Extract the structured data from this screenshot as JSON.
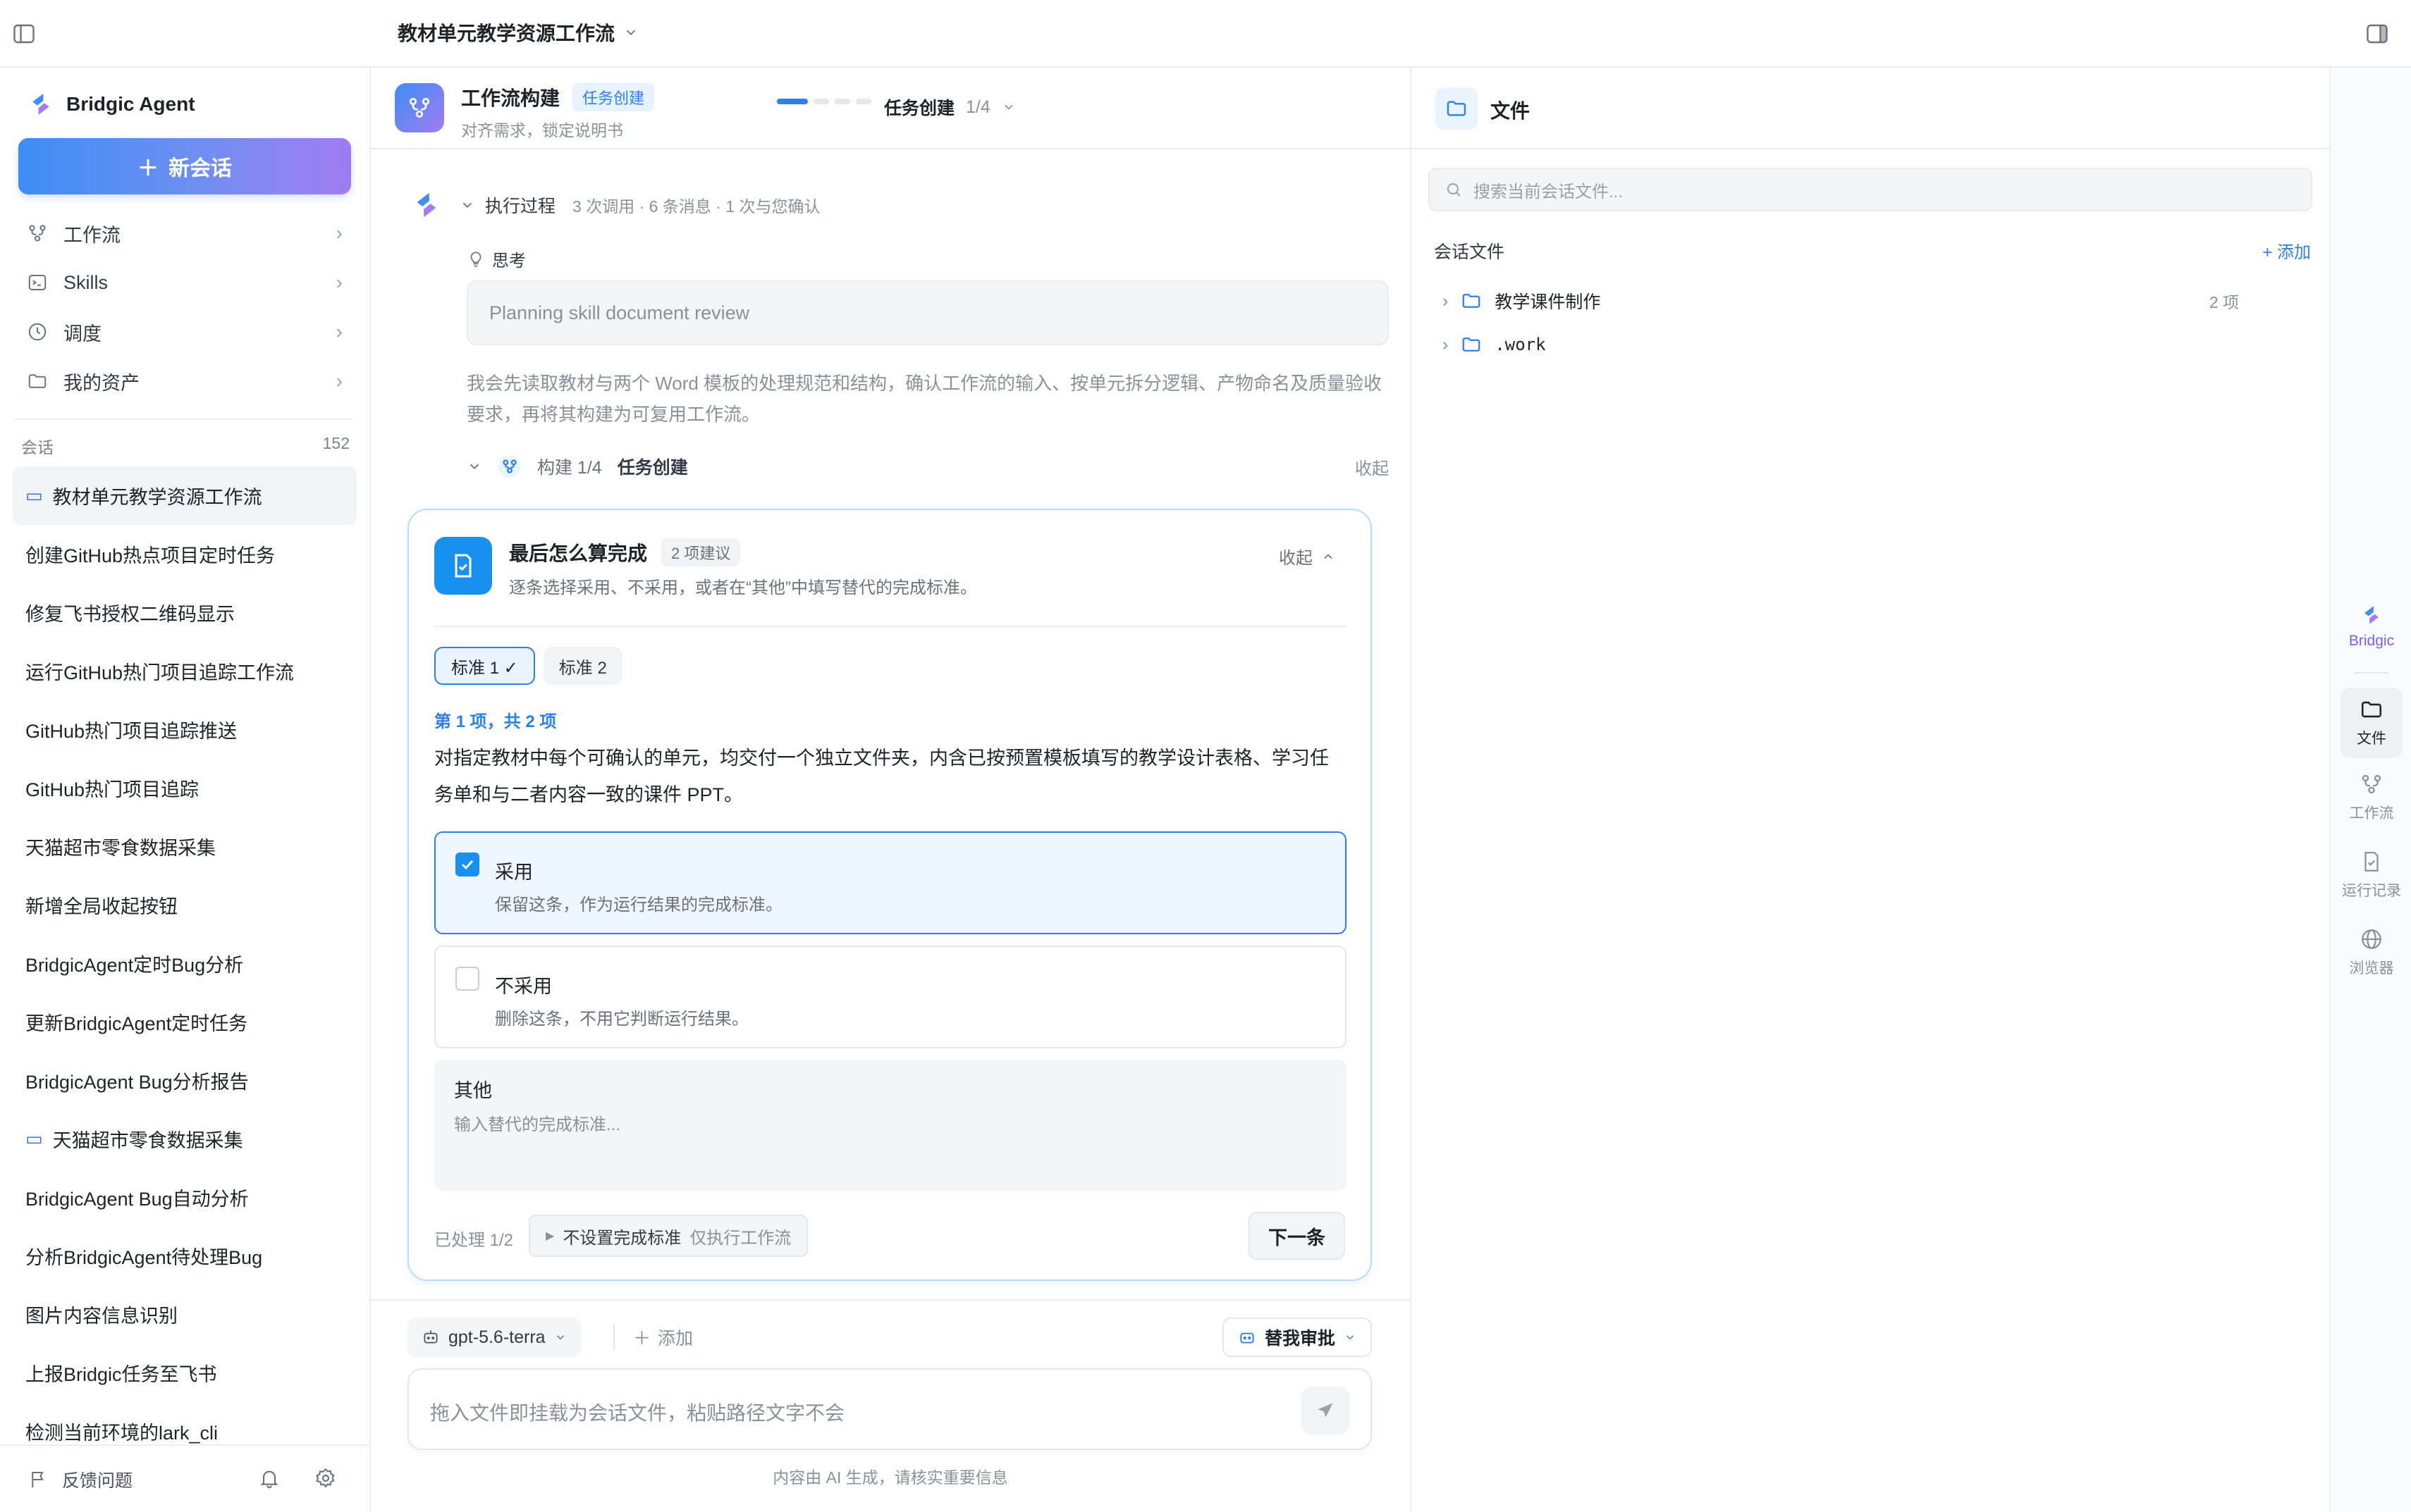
{
  "topbar": {
    "workflow_title": "教材单元教学资源工作流"
  },
  "sidebar": {
    "brand": "Bridgic Agent",
    "new_chat": "新会话",
    "nav": [
      {
        "label": "工作流",
        "icon": "workflow-icon"
      },
      {
        "label": "Skills",
        "icon": "terminal-icon"
      },
      {
        "label": "调度",
        "icon": "clock-icon"
      },
      {
        "label": "我的资产",
        "icon": "folder-icon"
      }
    ],
    "conversations_label": "会话",
    "conversations_count": "152",
    "conversations": [
      {
        "title": "教材单元教学资源工作流",
        "active": true,
        "icon": true
      },
      {
        "title": "创建GitHub热点项目定时任务"
      },
      {
        "title": "修复飞书授权二维码显示"
      },
      {
        "title": "运行GitHub热门项目追踪工作流"
      },
      {
        "title": "GitHub热门项目追踪推送"
      },
      {
        "title": "GitHub热门项目追踪"
      },
      {
        "title": "天猫超市零食数据采集"
      },
      {
        "title": "新增全局收起按钮"
      },
      {
        "title": "BridgicAgent定时Bug分析"
      },
      {
        "title": "更新BridgicAgent定时任务"
      },
      {
        "title": "BridgicAgent Bug分析报告"
      },
      {
        "title": "天猫超市零食数据采集",
        "icon": true
      },
      {
        "title": "BridgicAgent Bug自动分析"
      },
      {
        "title": "分析BridgicAgent待处理Bug"
      },
      {
        "title": "图片内容信息识别"
      },
      {
        "title": "上报Bridgic任务至飞书"
      },
      {
        "title": "检测当前环境的lark_cli"
      }
    ],
    "feedback": "反馈问题"
  },
  "header": {
    "name": "工作流构建",
    "tag": "任务创建",
    "subtitle": "对齐需求，锁定说明书",
    "step_label": "任务创建",
    "step_count": "1/4",
    "progress": {
      "current": 1,
      "total": 4
    }
  },
  "exec": {
    "title": "执行过程",
    "meta": "3 次调用 · 6 条消息 · 1 次与您确认",
    "think_label": "思考",
    "think_box": "Planning skill document review",
    "think_text": "我会先读取教材与两个 Word 模板的处理规范和结构，确认工作流的输入、按单元拆分逻辑、产物命名及质量验收要求，再将其构建为可复用工作流。",
    "build_num": "构建 1/4",
    "build_title": "任务创建",
    "build_collapse": "收起"
  },
  "card": {
    "title": "最后怎么算完成",
    "tag": "2 项建议",
    "subtitle": "逐条选择采用、不采用，或者在“其他”中填写替代的完成标准。",
    "collapse": "收起",
    "tabs": [
      "标准 1 ✓",
      "标准 2"
    ],
    "item_count": "第 1 项，共 2 项",
    "item_text": "对指定教材中每个可确认的单元，均交付一个独立文件夹，内含已按预置模板填写的教学设计表格、学习任务单和与二者内容一致的课件 PPT。",
    "option_adopt": {
      "label": "采用",
      "desc": "保留这条，作为运行结果的完成标准。"
    },
    "option_reject": {
      "label": "不采用",
      "desc": "删除这条，不用它判断运行结果。"
    },
    "other_label": "其他",
    "other_placeholder": "输入替代的完成标准...",
    "processed": "已处理 1/2",
    "skip_label": "不设置完成标准",
    "skip_hint": "仅执行工作流",
    "next": "下一条"
  },
  "composer": {
    "model": "gpt-5.6-terra",
    "add": "添加",
    "approve": "替我审批",
    "placeholder": "拖入文件即挂载为会话文件，粘贴路径文字不会",
    "ai_note": "内容由 AI 生成，请核实重要信息"
  },
  "files": {
    "title": "文件",
    "search_placeholder": "搜索当前会话文件...",
    "section": "会话文件",
    "add": "+ 添加",
    "tree": [
      {
        "name": "教学课件制作",
        "count": "2 项"
      },
      {
        "name": ".work",
        "count": ""
      }
    ]
  },
  "rail": {
    "brand": "Bridgic",
    "items": [
      "文件",
      "工作流",
      "运行记录",
      "浏览器"
    ]
  },
  "colors": {
    "accent": "#2d7ff0",
    "card_border": "#b8dcf7",
    "brand_gradient_end": "#a27cf0"
  }
}
